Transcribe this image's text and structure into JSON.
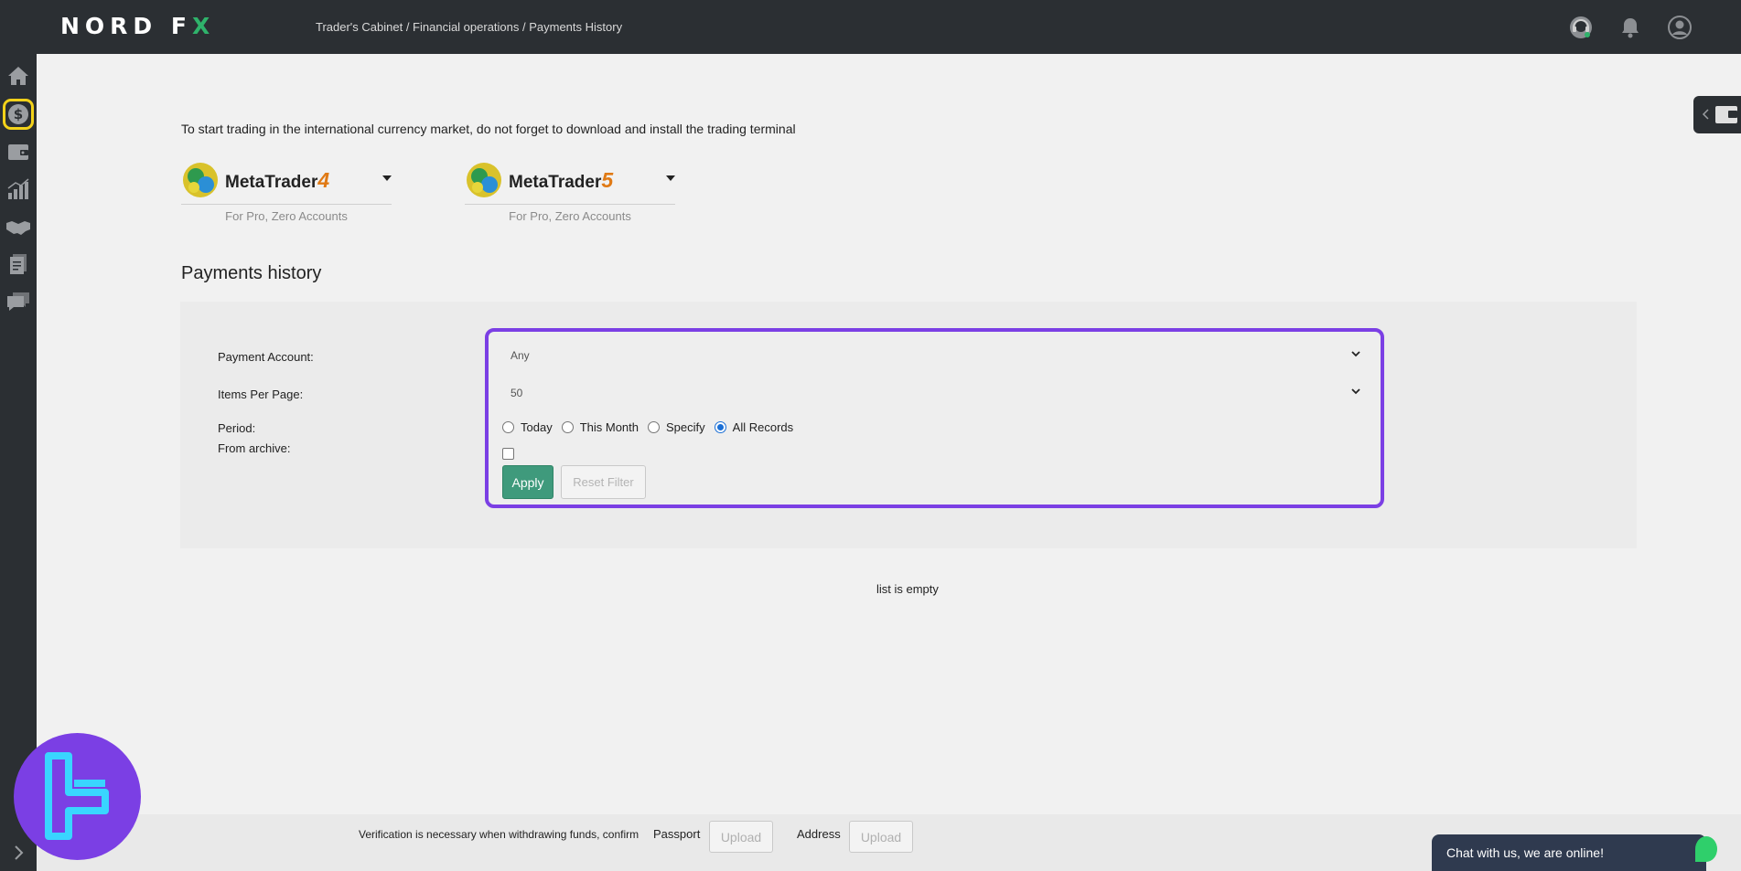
{
  "header": {
    "logo_left": "NORD ",
    "logo_f": "F",
    "logo_x": "X",
    "breadcrumb": "Trader's Cabinet / Financial operations / Payments History",
    "icons": [
      "support-icon",
      "bell-icon",
      "user-icon"
    ]
  },
  "sidebar": {
    "items": [
      {
        "icon": "home-icon"
      },
      {
        "icon": "dollar-icon",
        "active": true
      },
      {
        "icon": "wallet-icon"
      },
      {
        "icon": "chart-icon"
      },
      {
        "icon": "handshake-icon"
      },
      {
        "icon": "documents-icon"
      },
      {
        "icon": "chat-bubbles-icon"
      }
    ],
    "expand_icon": "chevron-right-icon",
    "active_highlight": "#f3d21a"
  },
  "intro_text": "To start trading in the international currency market, do not forget to download and install the trading terminal",
  "terminals": [
    {
      "name": "MetaTrader",
      "version": "4",
      "subtitle": "For Pro, Zero Accounts"
    },
    {
      "name": "MetaTrader",
      "version": "5",
      "subtitle": "For Pro, Zero Accounts"
    }
  ],
  "section_title": "Payments history",
  "filter": {
    "payment_account_label": "Payment Account:",
    "payment_account_value": "Any",
    "items_per_page_label": "Items Per Page:",
    "items_per_page_value": "50",
    "period_label": "Period:",
    "period_options": [
      {
        "label": "Today",
        "checked": false
      },
      {
        "label": "This Month",
        "checked": false
      },
      {
        "label": "Specify",
        "checked": false
      },
      {
        "label": "All Records",
        "checked": true
      }
    ],
    "archive_label": "From archive:",
    "archive_checked": false,
    "apply_label": "Apply",
    "reset_label": "Reset Filter",
    "highlight_color": "#7b3fe4"
  },
  "empty_message": "list is empty",
  "footer": {
    "verification_text": "Verification is necessary when withdrawing funds, confirm",
    "passport_label": "Passport",
    "address_label": "Address",
    "upload_label": "Upload"
  },
  "chat": {
    "label": "Chat with us, we are online!"
  },
  "colors": {
    "topbar": "#2b2f33",
    "apply": "#3f9a7c",
    "accent_orange": "#e07a15"
  }
}
